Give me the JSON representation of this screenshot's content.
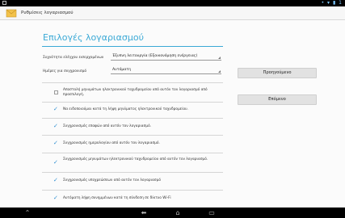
{
  "status": {
    "icons": "• ▾ ▮ 1"
  },
  "actionbar": {
    "title": "Ρυθμίσεις λογαριασμού",
    "icon": "envelope-icon"
  },
  "page": {
    "title": "Επιλογές λογαριασμού"
  },
  "settings": {
    "sync_frequency": {
      "label": "Συχνότητα ελέγχου εισερχομένων",
      "value": "Έξυπνη λειτουργία (Εξοικονόμηση ενέργειας)"
    },
    "sync_days": {
      "label": "Ημέρες για συγχρονισμό",
      "value": "Αυτόματη"
    }
  },
  "options": [
    {
      "text": "Αποστολή μηνυμάτων ηλεκτρονικού ταχυδρομείου από αυτόν τον λογαριασμό από προεπιλογή.",
      "checked": false
    },
    {
      "text": "Να ειδοποιούμαι κατά τη λήψη μηνύματος ηλεκτρονικού ταχυδρομείου.",
      "checked": true
    },
    {
      "text": "Συγχρονισμός επαφών από αυτόν τον λογαριασμό.",
      "checked": true
    },
    {
      "text": "Συγχρονισμός ημερολογίου από αυτόν τον λογαριασμό.",
      "checked": true
    },
    {
      "text": "Συγχρονισμός μηνυμάτων ηλεκτρονικού ταχυδρομείου από αυτόν τον λογαριασμό.",
      "checked": true
    },
    {
      "text": "Συγχρονισμός υποχρεώσεων από αυτόν τον λογαριασμό",
      "checked": true
    },
    {
      "text": "Αυτόματη λήψη συνημμένων κατά τη σύνδεση σε δίκτυο Wi-Fi",
      "checked": true
    }
  ],
  "buttons": {
    "previous": "Προηγούμενο",
    "next": "Επόμενο"
  },
  "nav": {
    "back": "⬅",
    "home": "⌂",
    "recents": "▭"
  }
}
